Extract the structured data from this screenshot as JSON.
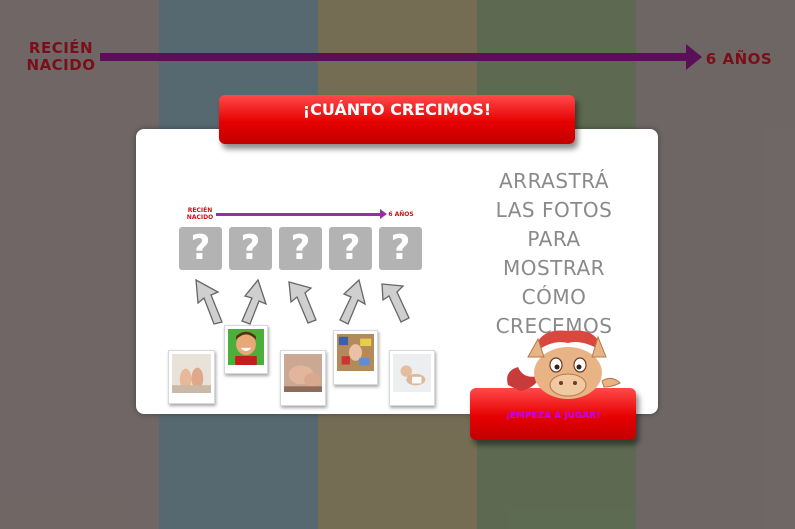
{
  "timeline": {
    "start_label": "RECIÉN\nNACIDO",
    "end_label": "6 AÑOS",
    "bar_color": "#5b0f59",
    "label_color": "#7a0f18"
  },
  "background_stripes": [
    "#776d6b",
    "#5a6f78",
    "#7d7558",
    "#627155",
    "#756d6c"
  ],
  "title": "¡CUÁNTO CRECIMOS!",
  "mini_timeline": {
    "start_label": "RECIÉN\nNACIDO",
    "end_label": "6 AÑOS"
  },
  "slots": [
    "?",
    "?",
    "?",
    "?",
    "?"
  ],
  "photos": [
    {
      "name": "photo-baby-feet"
    },
    {
      "name": "photo-smiling-boy"
    },
    {
      "name": "photo-sleeping-baby"
    },
    {
      "name": "photo-toddler-with-toys"
    },
    {
      "name": "photo-crawling-baby"
    }
  ],
  "instructions": [
    "ARRASTRÁ",
    "LAS FOTOS",
    "PARA",
    "MOSTRAR",
    "CÓMO",
    "CRECEMOS"
  ],
  "start_button": "¡EMPEZÁ A JUGAR!",
  "colors": {
    "accent_red": "#e60000",
    "button_text": "#c000ff",
    "slot_gray": "#b3b3b3"
  }
}
